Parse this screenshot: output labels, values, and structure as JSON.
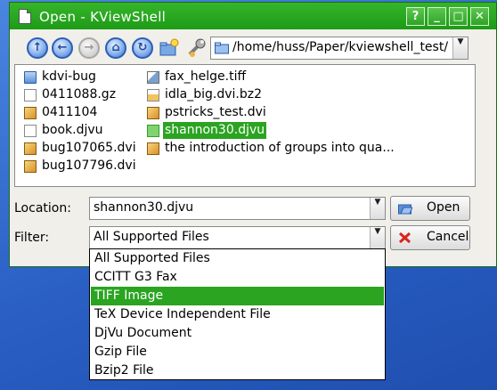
{
  "window": {
    "title": "Open - KViewShell",
    "buttons": {
      "help": "?",
      "minimize": "_",
      "maximize": "□",
      "close": "✕"
    }
  },
  "toolbar": {
    "up_icon": "up-arrow-icon",
    "back_icon": "back-arrow-icon",
    "forward_icon": "forward-arrow-icon",
    "home_icon": "home-icon",
    "reload_icon": "reload-icon",
    "new_folder_icon": "new-folder-icon",
    "configure_icon": "wrench-icon",
    "path": "/home/huss/Paper/kviewshell_test/"
  },
  "files": {
    "column1": [
      {
        "name": "kdvi-bug",
        "icon": "folder-icon"
      },
      {
        "name": "0411088.gz",
        "icon": "gzip-file-icon"
      },
      {
        "name": "0411104",
        "icon": "dvi-file-icon"
      },
      {
        "name": "book.djvu",
        "icon": "djvu-file-icon"
      },
      {
        "name": "bug107065.dvi",
        "icon": "dvi-file-icon"
      },
      {
        "name": "bug107796.dvi",
        "icon": "dvi-file-icon"
      }
    ],
    "column2": [
      {
        "name": "fax_helge.tiff",
        "icon": "image-file-icon"
      },
      {
        "name": "idla_big.dvi.bz2",
        "icon": "bzip2-file-icon"
      },
      {
        "name": "pstricks_test.dvi",
        "icon": "dvi-file-icon"
      },
      {
        "name": "shannon30.djvu",
        "icon": "djvu-file-icon",
        "selected": true
      },
      {
        "name": "the introduction of groups into qua...",
        "icon": "dvi-file-icon"
      }
    ]
  },
  "location": {
    "label": "Location:",
    "value": "shannon30.djvu"
  },
  "filter": {
    "label": "Filter:",
    "value": "All Supported Files",
    "options": [
      "All Supported Files",
      "CCITT G3 Fax",
      "TIFF Image",
      "TeX Device Independent File",
      "DjVu Document",
      "Gzip File",
      "Bzip2 File"
    ],
    "highlighted_index": 2
  },
  "buttons": {
    "open_label": "Open",
    "cancel_label": "Cancel"
  },
  "colors": {
    "accent_green": "#2aa421",
    "titlebar_green": "#1e9b17",
    "desktop_blue": "#2f63c8"
  }
}
